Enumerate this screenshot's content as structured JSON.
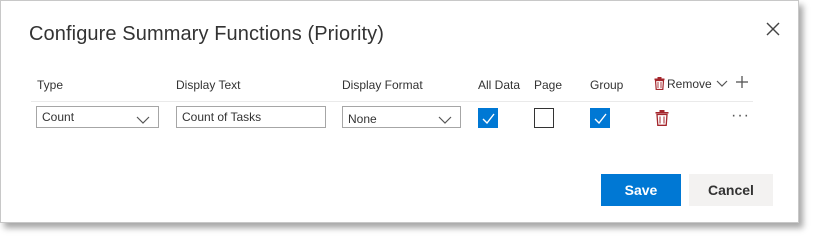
{
  "dialog": {
    "title": "Configure Summary Functions (Priority)"
  },
  "columns": {
    "type": "Type",
    "display_text": "Display Text",
    "display_format": "Display Format",
    "all_data": "All Data",
    "page": "Page",
    "group": "Group",
    "remove": "Remove"
  },
  "row": {
    "type_value": "Count",
    "display_text_value": "Count of Tasks",
    "display_format_value": "None",
    "all_data_checked": true,
    "page_checked": false,
    "group_checked": true,
    "more_label": "···"
  },
  "buttons": {
    "save": "Save",
    "cancel": "Cancel"
  },
  "colors": {
    "accent": "#0078d4",
    "trash": "#a4262c"
  },
  "icons": [
    "close-icon",
    "trash-icon",
    "chevron-down-icon",
    "plus-icon",
    "more-icon",
    "checkmark-icon"
  ]
}
